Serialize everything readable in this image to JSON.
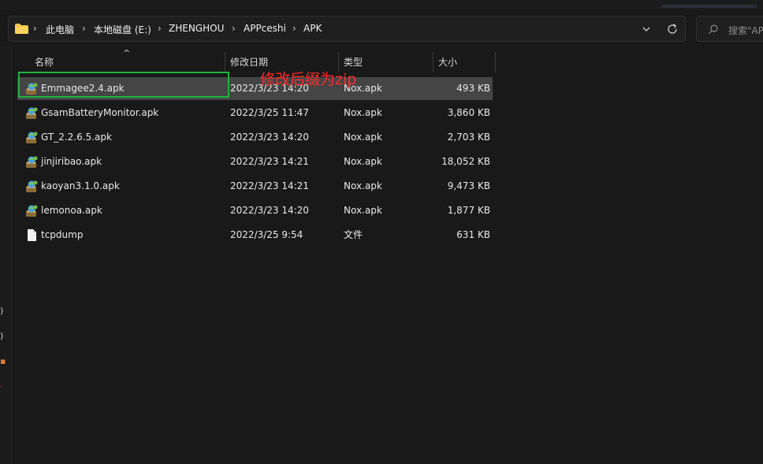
{
  "address_bar": {
    "breadcrumbs": [
      "此电脑",
      "本地磁盘 (E:)",
      "ZHENGHOU",
      "APPceshi",
      "APK"
    ]
  },
  "search": {
    "placeholder": "搜索\"APK\""
  },
  "columns": {
    "name": "名称",
    "date": "修改日期",
    "type": "类型",
    "size": "大小"
  },
  "files": [
    {
      "name": "Emmagee2.4.apk",
      "date": "2022/3/23 14:20",
      "type": "Nox.apk",
      "size": "493 KB",
      "icon": "apk-icon",
      "selected": true
    },
    {
      "name": "GsamBatteryMonitor.apk",
      "date": "2022/3/25 11:47",
      "type": "Nox.apk",
      "size": "3,860 KB",
      "icon": "apk-icon"
    },
    {
      "name": "GT_2.2.6.5.apk",
      "date": "2022/3/23 14:20",
      "type": "Nox.apk",
      "size": "2,703 KB",
      "icon": "apk-icon"
    },
    {
      "name": "jinjiribao.apk",
      "date": "2022/3/23 14:21",
      "type": "Nox.apk",
      "size": "18,052 KB",
      "icon": "apk-icon"
    },
    {
      "name": "kaoyan3.1.0.apk",
      "date": "2022/3/23 14:21",
      "type": "Nox.apk",
      "size": "9,473 KB",
      "icon": "apk-icon"
    },
    {
      "name": "lemonoa.apk",
      "date": "2022/3/23 14:20",
      "type": "Nox.apk",
      "size": "1,877 KB",
      "icon": "apk-icon"
    },
    {
      "name": "tcpdump",
      "date": "2022/3/25 9:54",
      "type": "文件",
      "size": "631 KB",
      "icon": "file-icon"
    }
  ],
  "annotation": {
    "text": "修改后缀为zip",
    "color": "#ff2a2a",
    "box_color": "#1db33e"
  },
  "colors": {
    "background": "#191919",
    "selected_row": "#454545"
  }
}
